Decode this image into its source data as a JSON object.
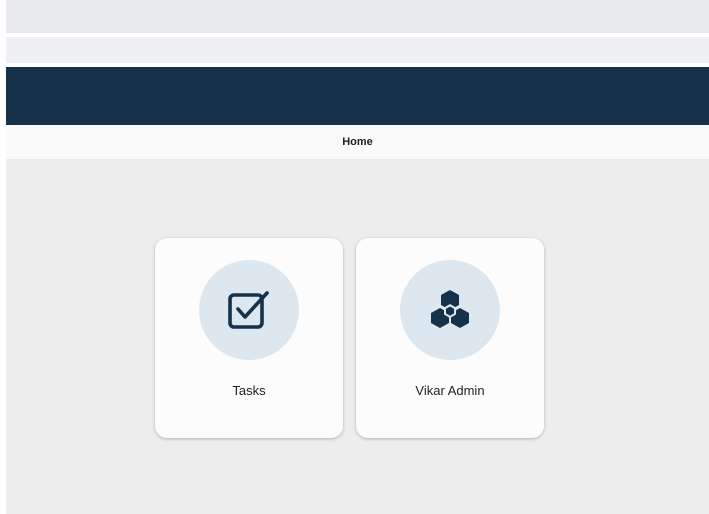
{
  "navigation": {
    "home_label": "Home"
  },
  "tiles": [
    {
      "label": "Tasks",
      "icon": "checkbox-icon"
    },
    {
      "label": "Vikar Admin",
      "icon": "cubes-icon"
    }
  ],
  "colors": {
    "header": "#16324a",
    "icon": "#16324a",
    "icon_circle": "#dde7f0",
    "content_bg": "#ededed",
    "tile_bg": "#fcfcfc"
  }
}
